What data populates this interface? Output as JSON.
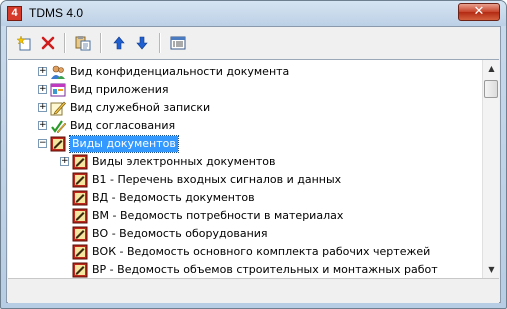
{
  "window": {
    "title": "TDMS 4.0",
    "icon_letter": "4",
    "close_glyph": "✕"
  },
  "toolbar": {
    "buttons": [
      {
        "name": "new-object-button",
        "icon": "new-star-icon"
      },
      {
        "name": "delete-button",
        "icon": "red-x-icon"
      },
      {
        "name": "copy-button",
        "icon": "clipboard-icon"
      },
      {
        "name": "move-up-button",
        "icon": "arrow-up-icon"
      },
      {
        "name": "move-down-button",
        "icon": "arrow-down-icon"
      },
      {
        "name": "properties-button",
        "icon": "list-window-icon"
      }
    ]
  },
  "tree": {
    "items": [
      {
        "label": "Вид конфиденциальности документа",
        "level": 0,
        "expander": "+",
        "icon": "users-icon"
      },
      {
        "label": "Вид приложения",
        "level": 0,
        "expander": "+",
        "icon": "app-window-icon"
      },
      {
        "label": "Вид служебной записки",
        "level": 0,
        "expander": "+",
        "icon": "pencil-note-icon"
      },
      {
        "label": "Вид согласования",
        "level": 0,
        "expander": "+",
        "icon": "checkmark-pen-icon"
      },
      {
        "label": "Виды документов",
        "level": 0,
        "expander": "−",
        "icon": "document-type-icon",
        "selected": true
      },
      {
        "label": "Виды электронных документов",
        "level": 1,
        "expander": "+",
        "icon": "document-type-icon"
      },
      {
        "label": "В1 - Перечень входных сигналов и данных",
        "level": 1,
        "expander": "",
        "icon": "document-type-icon"
      },
      {
        "label": "ВД - Ведомость документов",
        "level": 1,
        "expander": "",
        "icon": "document-type-icon"
      },
      {
        "label": "ВМ - Ведомость потребности в материалах",
        "level": 1,
        "expander": "",
        "icon": "document-type-icon"
      },
      {
        "label": "ВО - Ведомость оборудования",
        "level": 1,
        "expander": "",
        "icon": "document-type-icon"
      },
      {
        "label": "ВОК - Ведомость основного комплекта рабочих чертежей",
        "level": 1,
        "expander": "",
        "icon": "document-type-icon"
      },
      {
        "label": "ВР - Ведомость объемов строительных и монтажных работ",
        "level": 1,
        "expander": "",
        "icon": "document-type-icon"
      }
    ]
  },
  "scrollbar": {
    "up_glyph": "▲",
    "down_glyph": "▼"
  },
  "colors": {
    "selection": "#3399ff",
    "doc_icon_red": "#c0281c",
    "arrow_blue": "#1f5fd0"
  }
}
